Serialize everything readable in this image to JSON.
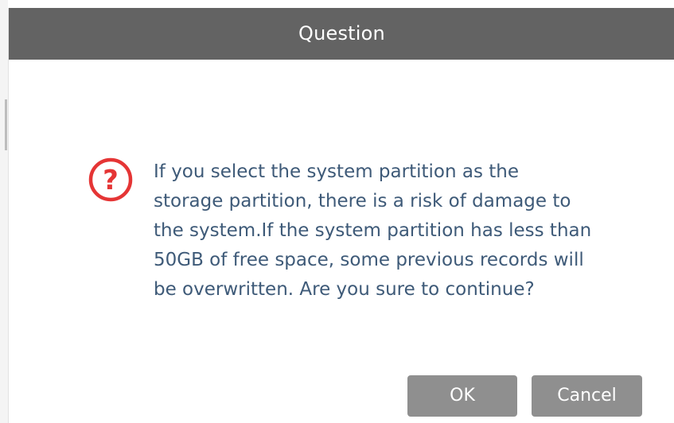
{
  "dialog": {
    "title": "Question",
    "icon": "question-circle-icon",
    "message": "If you select the system partition as the\nstorage partition, there is a risk of damage to\nthe system.If the system partition has less than\n50GB of free space, some previous records will\nbe overwritten. Are you sure to continue?",
    "buttons": {
      "ok_label": "OK",
      "cancel_label": "Cancel"
    }
  },
  "colors": {
    "titlebar": "#636363",
    "title_text": "#ffffff",
    "message_text": "#3e5a78",
    "icon": "#e53535",
    "button": "#8f8f8f",
    "button_text": "#ffffff"
  }
}
